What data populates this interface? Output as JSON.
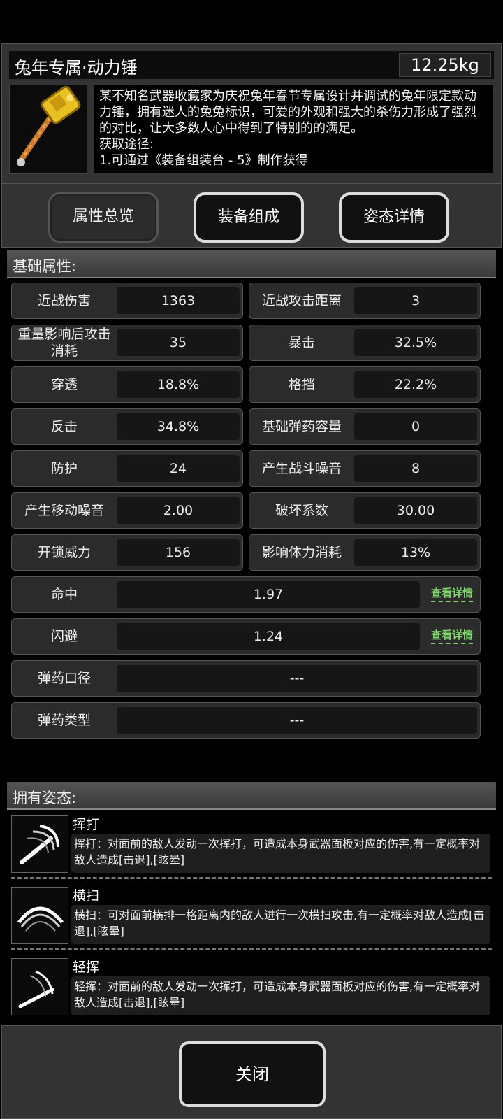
{
  "item": {
    "name": "兔年专属·动力锤",
    "weight": "12.25kg",
    "description": "某不知名武器收藏家为庆祝兔年春节专属设计并调试的兔年限定款动力锤，拥有迷人的兔兔标识，可爱的外观和强大的杀伤力形成了强烈的对比，让大多数人心中得到了特别的的满足。",
    "source_label": "获取途径:",
    "source_partial": "1.可通过《装备组装台 - 5》制作获得"
  },
  "tabs": [
    {
      "label": "属性总览",
      "active": true
    },
    {
      "label": "装备组成",
      "active": false
    },
    {
      "label": "姿态详情",
      "active": false
    }
  ],
  "base_attributes": {
    "title": "基础属性:",
    "pairs": [
      [
        {
          "label": "近战伤害",
          "value": "1363"
        },
        {
          "label": "近战攻击距离",
          "value": "3"
        }
      ],
      [
        {
          "label": "重量影响后攻击消耗",
          "value": "35"
        },
        {
          "label": "暴击",
          "value": "32.5%"
        }
      ],
      [
        {
          "label": "穿透",
          "value": "18.8%"
        },
        {
          "label": "格挡",
          "value": "22.2%"
        }
      ],
      [
        {
          "label": "反击",
          "value": "34.8%"
        },
        {
          "label": "基础弹药容量",
          "value": "0"
        }
      ],
      [
        {
          "label": "防护",
          "value": "24"
        },
        {
          "label": "产生战斗噪音",
          "value": "8"
        }
      ],
      [
        {
          "label": "产生移动噪音",
          "value": "2.00"
        },
        {
          "label": "破坏系数",
          "value": "30.00"
        }
      ],
      [
        {
          "label": "开锁威力",
          "value": "156"
        },
        {
          "label": "影响体力消耗",
          "value": "13%"
        }
      ]
    ],
    "wide": [
      {
        "label": "命中",
        "value": "1.97",
        "link": "查看详情"
      },
      {
        "label": "闪避",
        "value": "1.24",
        "link": "查看详情"
      },
      {
        "label": "弹药口径",
        "value": "---"
      },
      {
        "label": "弹药类型",
        "value": "---"
      }
    ]
  },
  "stances": {
    "title": "拥有姿态:",
    "items": [
      {
        "name": "挥打",
        "icon": "swing-icon",
        "desc": "挥打：对面前的敌人发动一次挥打，可造成本身武器面板对应的伤害,有一定概率对敌人造成[击退],[眩晕]"
      },
      {
        "name": "横扫",
        "icon": "sweep-icon",
        "desc": "横扫：可对面前横排一格距离内的敌人进行一次横扫攻击,有一定概率对敌人造成[击退],[眩晕]"
      },
      {
        "name": "轻挥",
        "icon": "light-swing-icon",
        "desc": "轻挥：对面前的敌人发动一次挥打，可造成本身武器面板对应的伤害,有一定概率对敌人造成[击退],[眩晕]"
      }
    ]
  },
  "close_label": "关闭",
  "colors": {
    "link": "#7ed86a",
    "panel": "#333333",
    "cell": "#2b2b2b"
  }
}
